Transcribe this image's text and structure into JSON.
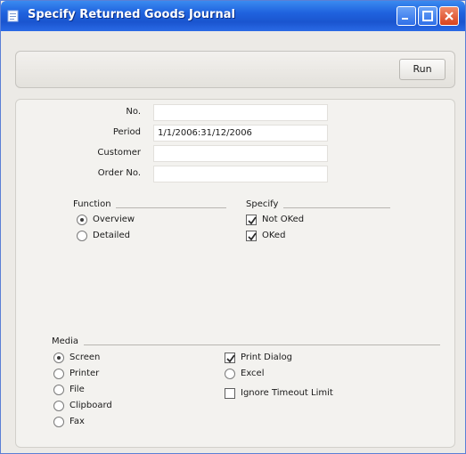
{
  "window": {
    "title": "Specify Returned Goods Journal"
  },
  "toolbar": {
    "run_label": "Run"
  },
  "fields": [
    {
      "label": "No.",
      "value": ""
    },
    {
      "label": "Period",
      "value": "1/1/2006:31/12/2006"
    },
    {
      "label": "Customer",
      "value": ""
    },
    {
      "label": "Order No.",
      "value": ""
    }
  ],
  "function_group": {
    "label": "Function",
    "options": [
      {
        "label": "Overview",
        "selected": true
      },
      {
        "label": "Detailed",
        "selected": false
      }
    ]
  },
  "specify_group": {
    "label": "Specify",
    "options": [
      {
        "label": "Not OKed",
        "checked": true
      },
      {
        "label": "OKed",
        "checked": true
      }
    ]
  },
  "media_group": {
    "label": "Media",
    "options": [
      {
        "label": "Screen",
        "selected": true
      },
      {
        "label": "Printer",
        "selected": false
      },
      {
        "label": "File",
        "selected": false
      },
      {
        "label": "Clipboard",
        "selected": false
      },
      {
        "label": "Fax",
        "selected": false
      }
    ]
  },
  "media_extras": {
    "print_dialog": {
      "label": "Print Dialog",
      "checked": true
    },
    "excel": {
      "label": "Excel",
      "selected": false
    },
    "ignore_timeout": {
      "label": "Ignore Timeout Limit",
      "checked": false
    }
  },
  "colors": {
    "titlebar": "#1f62de",
    "window_bg": "#eceae6"
  }
}
